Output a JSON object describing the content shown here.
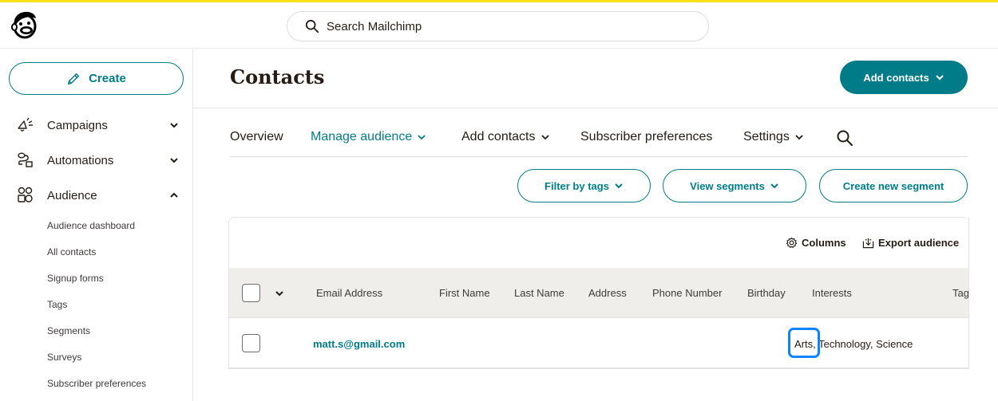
{
  "app": {
    "name": "Mailchimp",
    "accent_color": "#ffe01b",
    "brand_color": "#007c89",
    "highlight_color": "#0a84ff"
  },
  "topbar": {
    "logo_icon": "mailchimp-freddie-logo",
    "search": {
      "icon": "search-icon",
      "placeholder": "Search Mailchimp",
      "value": ""
    }
  },
  "sidebar": {
    "create_label": "Create",
    "create_icon": "pencil-icon",
    "items": [
      {
        "label": "Campaigns",
        "icon": "megaphone-icon",
        "expanded": false
      },
      {
        "label": "Automations",
        "icon": "workflow-icon",
        "expanded": false
      },
      {
        "label": "Audience",
        "icon": "audience-icon",
        "expanded": true
      }
    ],
    "audience_subitems": [
      "Audience dashboard",
      "All contacts",
      "Signup forms",
      "Tags",
      "Segments",
      "Surveys",
      "Subscriber preferences"
    ]
  },
  "header": {
    "title": "Contacts",
    "add_contacts_label": "Add contacts"
  },
  "tabs": [
    {
      "label": "Overview",
      "active": false,
      "dropdown": false
    },
    {
      "label": "Manage audience",
      "active": true,
      "dropdown": true
    },
    {
      "label": "Add contacts",
      "active": false,
      "dropdown": true
    },
    {
      "label": "Subscriber preferences",
      "active": false,
      "dropdown": false
    },
    {
      "label": "Settings",
      "active": false,
      "dropdown": true
    }
  ],
  "actions": {
    "filter_by_tags": "Filter by tags",
    "view_segments": "View segments",
    "create_new_segment": "Create new segment"
  },
  "table": {
    "toolbar": {
      "columns_label": "Columns",
      "export_label": "Export audience"
    },
    "columns": [
      "Email Address",
      "First Name",
      "Last Name",
      "Address",
      "Phone Number",
      "Birthday",
      "Interests",
      "Tags"
    ],
    "rows": [
      {
        "email": "matt.s@gmail.com",
        "first_name": "",
        "last_name": "",
        "address": "",
        "phone": "",
        "birthday": "",
        "interests": "Arts, Technology, Science",
        "tags": "",
        "checked": false
      }
    ]
  }
}
